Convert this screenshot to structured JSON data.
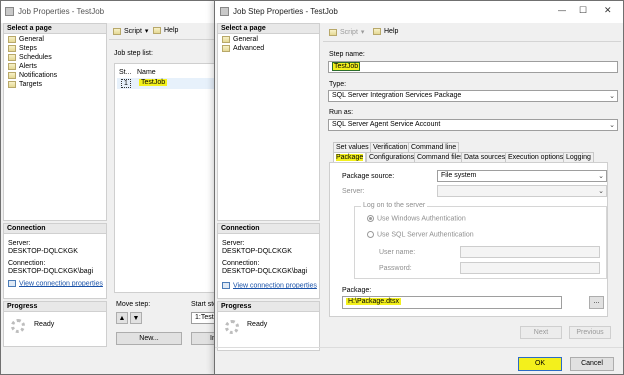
{
  "job_props": {
    "title": "Job Properties - TestJob",
    "select_page_header": "Select a page",
    "pages": [
      "General",
      "Steps",
      "Schedules",
      "Alerts",
      "Notifications",
      "Targets"
    ],
    "toolbar": {
      "script": "Script",
      "help": "Help"
    },
    "job_step_list_label": "Job step list:",
    "table": {
      "headers": [
        "St...",
        "Name"
      ],
      "rows": [
        {
          "step": "1",
          "name": "TestJob"
        }
      ]
    },
    "connection_header": "Connection",
    "server_label": "Server:",
    "server_value": "DESKTOP-DQLCKGK",
    "connection_label": "Connection:",
    "connection_value": "DESKTOP-DQLCKGK\\bagi",
    "view_connection": "View connection properties",
    "progress_header": "Progress",
    "progress_status": "Ready",
    "move_step_label": "Move step:",
    "start_step_label": "Start ste",
    "start_step_value": "1:TestJ",
    "new_button": "New...",
    "insert_button": "In"
  },
  "step_props": {
    "title": "Job Step Properties - TestJob",
    "window_controls": {
      "minimize": "—",
      "maximize": "☐",
      "close": "✕"
    },
    "select_page_header": "Select a page",
    "pages": [
      "General",
      "Advanced"
    ],
    "toolbar": {
      "script": "Script",
      "help": "Help"
    },
    "step_name_label": "Step name:",
    "step_name_value": "TestJob",
    "type_label": "Type:",
    "type_value": "SQL Server Integration Services Package",
    "run_as_label": "Run as:",
    "run_as_value": "SQL Server Agent Service Account",
    "tabs_row1": [
      "Set values",
      "Verification",
      "Command line"
    ],
    "tabs_row2": [
      "Package",
      "Configurations",
      "Command files",
      "Data sources",
      "Execution options",
      "Logging"
    ],
    "package_source_label": "Package source:",
    "package_source_value": "File system",
    "server_label": "Server:",
    "log_on_label": "Log on to the server",
    "windows_auth": "Use Windows Authentication",
    "sql_auth": "Use SQL Server Authentication",
    "user_name_label": "User name:",
    "password_label": "Password:",
    "package_label": "Package:",
    "package_value": "H:\\Package.dtsx",
    "browse_button": "...",
    "next_button": "Next",
    "previous_button": "Previous",
    "ok_button": "OK",
    "cancel_button": "Cancel",
    "connection_header": "Connection",
    "server_label2": "Server:",
    "server_value": "DESKTOP-DQLCKGK",
    "connection_label": "Connection:",
    "connection_value": "DESKTOP-DQLCKGK\\bagi",
    "view_connection": "View connection properties",
    "progress_header": "Progress",
    "progress_status": "Ready"
  },
  "colors": {
    "highlight": "#f3f01c",
    "link": "#1a52a8"
  }
}
